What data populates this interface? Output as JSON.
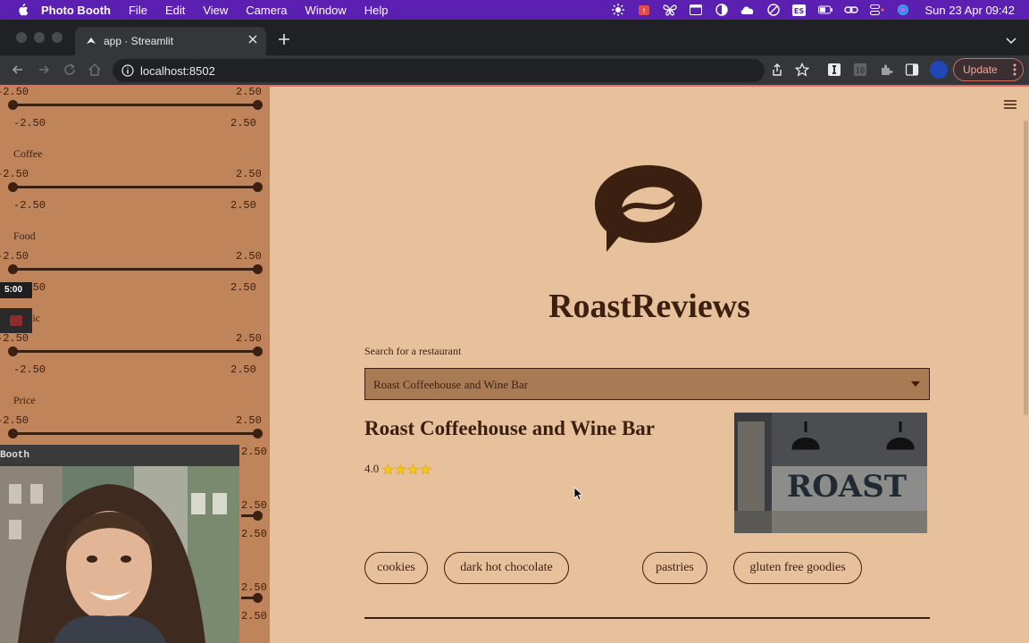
{
  "menubar": {
    "app_name": "Photo Booth",
    "items": [
      "File",
      "Edit",
      "View",
      "Camera",
      "Window",
      "Help"
    ],
    "status_icons": [
      "brightness-icon",
      "notification-badge-icon",
      "butterfly-icon",
      "window-icon",
      "half-circle-icon",
      "cloud-icon",
      "vpn-icon",
      "input-source-icon",
      "battery-icon",
      "link-icon",
      "control-center-icon",
      "siri-icon"
    ],
    "input_source": "ES",
    "clock": "Sun 23 Apr  09:42",
    "bg_color": "#5b1fb2"
  },
  "browser": {
    "tab_title": "app · Streamlit",
    "url": "localhost:8502",
    "update_label": "Update"
  },
  "sidebar": {
    "sliders": [
      {
        "label": "",
        "min": "-2.50",
        "max": "2.50",
        "low": "-2.50",
        "high": "2.50"
      },
      {
        "label": "Coffee",
        "min": "-2.50",
        "max": "2.50",
        "low": "-2.50",
        "high": "2.50"
      },
      {
        "label": "Food",
        "min": "-2.50",
        "max": "2.50",
        "low": "-2.50",
        "high": "2.50"
      },
      {
        "label": "Music",
        "min": "-2.50",
        "max": "2.50",
        "low": "-2.50",
        "high": "2.50"
      },
      {
        "label": "Price",
        "min": "-2.50",
        "max": "2.50",
        "low": "-2.50",
        "high": "2.50"
      }
    ],
    "overlay_timer": "5:00",
    "booth_title": "Booth"
  },
  "main": {
    "brand": "RoastReviews",
    "search_label": "Search for a restaurant",
    "search_value": "Roast Coffeehouse and Wine Bar",
    "restaurant_name": "Roast Coffeehouse and Wine Bar",
    "rating_value": "4.0",
    "stars": 4,
    "photo_text": "ROAST",
    "tags": [
      "cookies",
      "dark hot chocolate",
      "pastries",
      "gluten free goodies"
    ]
  },
  "colors": {
    "accent": "#e16d57",
    "text": "#3b1f10",
    "background": "#e7c19b",
    "sidebar": "#bf8459"
  }
}
